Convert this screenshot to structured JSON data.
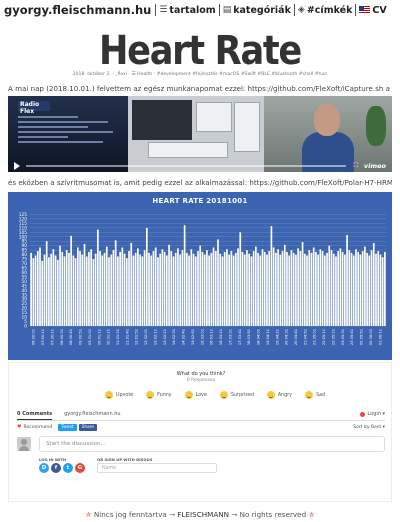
{
  "nav": {
    "site": "gyorgy.fleischmann.hu",
    "items": [
      {
        "icon": "list-icon",
        "glyph": "☰",
        "label": "tartalom"
      },
      {
        "icon": "grid-icon",
        "glyph": "▤",
        "label": "kategóriák"
      },
      {
        "icon": "tag-icon",
        "glyph": "◈",
        "label": "#címkék"
      },
      {
        "icon": "flag-icon",
        "glyph": "",
        "label": "CV"
      }
    ]
  },
  "post": {
    "title": "Heart Rate",
    "meta": "2018. október 2. · _flexi · ☰ Health · #development #fejlesztés #macOS #Swift #BLE #bluetooth #shell #hun",
    "para1": "A mai nap (2018.10.01.) felvettem az egész munkanapomat ezzel: https://github.com/FleXoft/iCapture.sh a szkripttel:",
    "para2": "és eközben a szívritmusomat is, amit pedig ezzel az alkalmazással: https://github.com/FleXoft/Polar-H7-HRM"
  },
  "video": {
    "window_title": "Radio Flex",
    "brand": "vimeo"
  },
  "chart_data": {
    "type": "bar",
    "title": "HEART RATE 20181001",
    "ylim": [
      0,
      130
    ],
    "yticks": [
      0,
      5,
      10,
      15,
      20,
      25,
      30,
      35,
      40,
      45,
      50,
      55,
      60,
      65,
      70,
      75,
      80,
      85,
      90,
      95,
      100,
      105,
      110,
      115,
      120,
      125
    ],
    "grid": true,
    "n_points": 160,
    "values": [
      82,
      76,
      79,
      84,
      88,
      73,
      80,
      95,
      77,
      81,
      86,
      79,
      74,
      90,
      83,
      78,
      85,
      82,
      101,
      79,
      76,
      88,
      84,
      80,
      92,
      78,
      83,
      86,
      75,
      81,
      108,
      84,
      79,
      82,
      89,
      77,
      80,
      85,
      96,
      78,
      83,
      88,
      81,
      76,
      84,
      93,
      79,
      82,
      87,
      80,
      78,
      85,
      110,
      82,
      79,
      84,
      88,
      77,
      81,
      86,
      83,
      79,
      91,
      84,
      78,
      82,
      87,
      80,
      85,
      113,
      82,
      79,
      86,
      81,
      78,
      84,
      90,
      83,
      80,
      85,
      79,
      82,
      88,
      84,
      97,
      81,
      78,
      83,
      86,
      80,
      84,
      79,
      82,
      87,
      105,
      83,
      80,
      85,
      81,
      78,
      84,
      89,
      82,
      79,
      86,
      83,
      80,
      84,
      112,
      88,
      82,
      86,
      80,
      84,
      91,
      83,
      79,
      85,
      82,
      80,
      87,
      84,
      94,
      81,
      79,
      85,
      82,
      88,
      83,
      80,
      86,
      84,
      79,
      82,
      90,
      85,
      81,
      78,
      84,
      87,
      83,
      80,
      102,
      85,
      82,
      79,
      86,
      83,
      80,
      84,
      89,
      82,
      79,
      85,
      93,
      81,
      84,
      80,
      77,
      83
    ],
    "x_tick_labels": [
      "06:30:01",
      "07:00:11",
      "07:30:21",
      "08:00:31",
      "08:30:41",
      "09:00:51",
      "09:31:01",
      "10:01:11",
      "10:31:21",
      "11:01:31",
      "11:31:41",
      "12:01:51",
      "12:32:01",
      "13:02:11",
      "13:32:21",
      "14:02:31",
      "14:32:41",
      "15:02:51",
      "15:33:01",
      "16:03:11",
      "16:33:21",
      "17:03:31",
      "17:33:41",
      "18:03:51",
      "18:34:01",
      "19:04:11",
      "19:34:21",
      "20:04:31",
      "20:34:41",
      "21:04:51",
      "21:35:01",
      "22:05:11",
      "22:35:21",
      "23:05:31",
      "23:35:41",
      "00:05:51",
      "00:36:01",
      "01:06:11"
    ]
  },
  "comments": {
    "question": "What do you think?",
    "responses": "0 Responses",
    "reactions": [
      "Upvote",
      "Funny",
      "Love",
      "Surprised",
      "Angry",
      "Sad"
    ],
    "tab_comments": "0 Comments",
    "tab_site": "gyorgy.fleischmann.hu",
    "login": "Login ▾",
    "recommend": "Recommend",
    "tweet": "Tweet",
    "share": "Share",
    "sort": "Sort by Best ▾",
    "placeholder": "Start the discussion...",
    "login_with": "LOG IN WITH",
    "or_sign": "OR SIGN UP WITH DISQUS",
    "name_placeholder": "Name",
    "social": [
      {
        "letter": "D",
        "color": "#2e9fff"
      },
      {
        "letter": "f",
        "color": "#3b5998"
      },
      {
        "letter": "t",
        "color": "#1da1f2"
      },
      {
        "letter": "G",
        "color": "#dd4b39"
      }
    ]
  },
  "footer": {
    "star": "✮",
    "text_before": "Nincs jog fenntartva ⊸ ",
    "brand": "FLEISCHMANN",
    "text_after": " ⊸ No rights reserved "
  }
}
